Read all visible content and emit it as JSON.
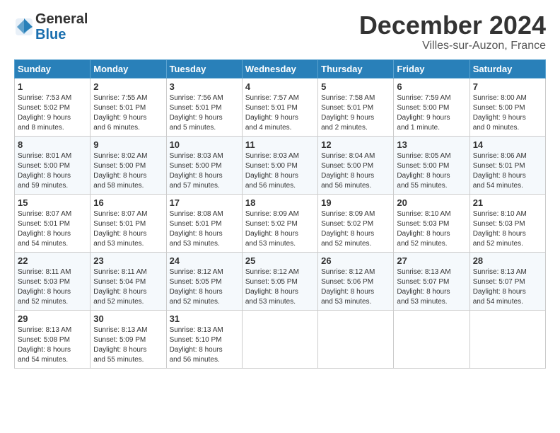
{
  "header": {
    "logo_line1": "General",
    "logo_line2": "Blue",
    "month": "December 2024",
    "location": "Villes-sur-Auzon, France"
  },
  "weekdays": [
    "Sunday",
    "Monday",
    "Tuesday",
    "Wednesday",
    "Thursday",
    "Friday",
    "Saturday"
  ],
  "weeks": [
    [
      {
        "day": "1",
        "info": "Sunrise: 7:53 AM\nSunset: 5:02 PM\nDaylight: 9 hours\nand 8 minutes."
      },
      {
        "day": "2",
        "info": "Sunrise: 7:55 AM\nSunset: 5:01 PM\nDaylight: 9 hours\nand 6 minutes."
      },
      {
        "day": "3",
        "info": "Sunrise: 7:56 AM\nSunset: 5:01 PM\nDaylight: 9 hours\nand 5 minutes."
      },
      {
        "day": "4",
        "info": "Sunrise: 7:57 AM\nSunset: 5:01 PM\nDaylight: 9 hours\nand 4 minutes."
      },
      {
        "day": "5",
        "info": "Sunrise: 7:58 AM\nSunset: 5:01 PM\nDaylight: 9 hours\nand 2 minutes."
      },
      {
        "day": "6",
        "info": "Sunrise: 7:59 AM\nSunset: 5:00 PM\nDaylight: 9 hours\nand 1 minute."
      },
      {
        "day": "7",
        "info": "Sunrise: 8:00 AM\nSunset: 5:00 PM\nDaylight: 9 hours\nand 0 minutes."
      }
    ],
    [
      {
        "day": "8",
        "info": "Sunrise: 8:01 AM\nSunset: 5:00 PM\nDaylight: 8 hours\nand 59 minutes."
      },
      {
        "day": "9",
        "info": "Sunrise: 8:02 AM\nSunset: 5:00 PM\nDaylight: 8 hours\nand 58 minutes."
      },
      {
        "day": "10",
        "info": "Sunrise: 8:03 AM\nSunset: 5:00 PM\nDaylight: 8 hours\nand 57 minutes."
      },
      {
        "day": "11",
        "info": "Sunrise: 8:03 AM\nSunset: 5:00 PM\nDaylight: 8 hours\nand 56 minutes."
      },
      {
        "day": "12",
        "info": "Sunrise: 8:04 AM\nSunset: 5:00 PM\nDaylight: 8 hours\nand 56 minutes."
      },
      {
        "day": "13",
        "info": "Sunrise: 8:05 AM\nSunset: 5:00 PM\nDaylight: 8 hours\nand 55 minutes."
      },
      {
        "day": "14",
        "info": "Sunrise: 8:06 AM\nSunset: 5:01 PM\nDaylight: 8 hours\nand 54 minutes."
      }
    ],
    [
      {
        "day": "15",
        "info": "Sunrise: 8:07 AM\nSunset: 5:01 PM\nDaylight: 8 hours\nand 54 minutes."
      },
      {
        "day": "16",
        "info": "Sunrise: 8:07 AM\nSunset: 5:01 PM\nDaylight: 8 hours\nand 53 minutes."
      },
      {
        "day": "17",
        "info": "Sunrise: 8:08 AM\nSunset: 5:01 PM\nDaylight: 8 hours\nand 53 minutes."
      },
      {
        "day": "18",
        "info": "Sunrise: 8:09 AM\nSunset: 5:02 PM\nDaylight: 8 hours\nand 53 minutes."
      },
      {
        "day": "19",
        "info": "Sunrise: 8:09 AM\nSunset: 5:02 PM\nDaylight: 8 hours\nand 52 minutes."
      },
      {
        "day": "20",
        "info": "Sunrise: 8:10 AM\nSunset: 5:03 PM\nDaylight: 8 hours\nand 52 minutes."
      },
      {
        "day": "21",
        "info": "Sunrise: 8:10 AM\nSunset: 5:03 PM\nDaylight: 8 hours\nand 52 minutes."
      }
    ],
    [
      {
        "day": "22",
        "info": "Sunrise: 8:11 AM\nSunset: 5:03 PM\nDaylight: 8 hours\nand 52 minutes."
      },
      {
        "day": "23",
        "info": "Sunrise: 8:11 AM\nSunset: 5:04 PM\nDaylight: 8 hours\nand 52 minutes."
      },
      {
        "day": "24",
        "info": "Sunrise: 8:12 AM\nSunset: 5:05 PM\nDaylight: 8 hours\nand 52 minutes."
      },
      {
        "day": "25",
        "info": "Sunrise: 8:12 AM\nSunset: 5:05 PM\nDaylight: 8 hours\nand 53 minutes."
      },
      {
        "day": "26",
        "info": "Sunrise: 8:12 AM\nSunset: 5:06 PM\nDaylight: 8 hours\nand 53 minutes."
      },
      {
        "day": "27",
        "info": "Sunrise: 8:13 AM\nSunset: 5:07 PM\nDaylight: 8 hours\nand 53 minutes."
      },
      {
        "day": "28",
        "info": "Sunrise: 8:13 AM\nSunset: 5:07 PM\nDaylight: 8 hours\nand 54 minutes."
      }
    ],
    [
      {
        "day": "29",
        "info": "Sunrise: 8:13 AM\nSunset: 5:08 PM\nDaylight: 8 hours\nand 54 minutes."
      },
      {
        "day": "30",
        "info": "Sunrise: 8:13 AM\nSunset: 5:09 PM\nDaylight: 8 hours\nand 55 minutes."
      },
      {
        "day": "31",
        "info": "Sunrise: 8:13 AM\nSunset: 5:10 PM\nDaylight: 8 hours\nand 56 minutes."
      },
      null,
      null,
      null,
      null
    ]
  ]
}
